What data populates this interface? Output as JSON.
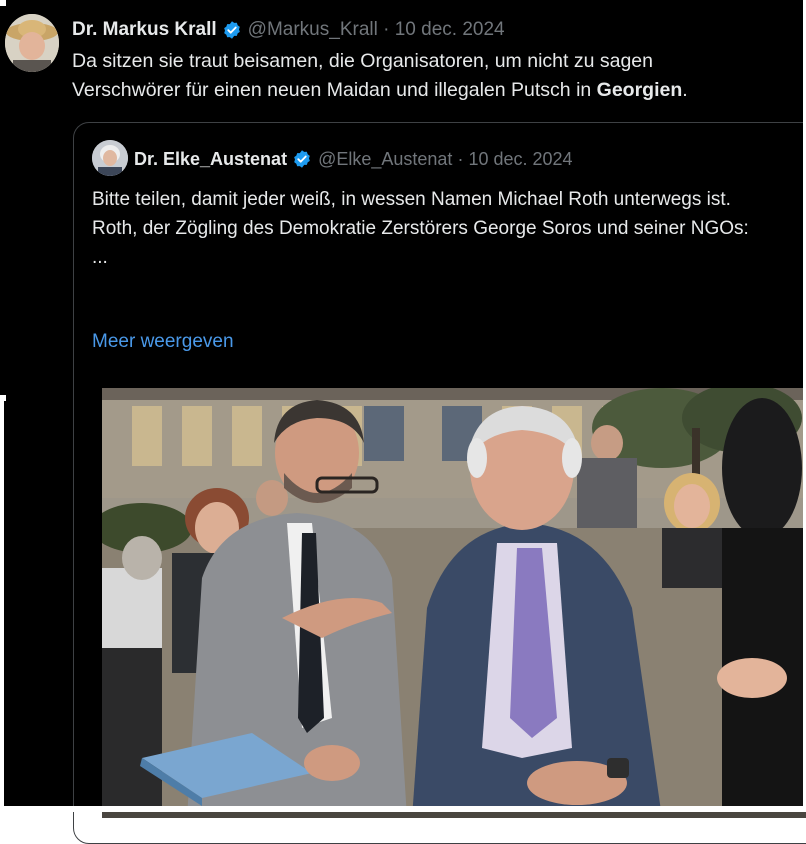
{
  "tweet": {
    "author_name": "Dr. Markus Krall",
    "handle": "@Markus_Krall",
    "separator": "·",
    "date": "10 dec. 2024",
    "text_line1": "Da sitzen sie traut beisamen, die Organisatoren, um nicht zu sagen",
    "text_line2_pre": "Verschwörer für einen neuen Maidan und illegalen Putsch in ",
    "text_line2_bold": "Georgien",
    "text_line2_post": "."
  },
  "quoted": {
    "author_name": "Dr. Elke_Austenat",
    "handle": "@Elke_Austenat",
    "separator": "·",
    "date": "10 dec. 2024",
    "para1": "Bitte teilen, damit jeder weiß, in wessen Namen Michael Roth unterwegs ist.",
    "para2": "Roth, der Zögling des Demokratie Zerstörers George Soros und seiner NGOs:",
    "ellipsis": "...",
    "show_more": "Meer weergeven"
  },
  "icons": {
    "verified": "verified-badge-icon"
  },
  "colors": {
    "background": "#000000",
    "text": "#e7e9ea",
    "muted": "#71767b",
    "link": "#4a99e9",
    "verified": "#1d9bf0",
    "border": "#3e4144"
  }
}
